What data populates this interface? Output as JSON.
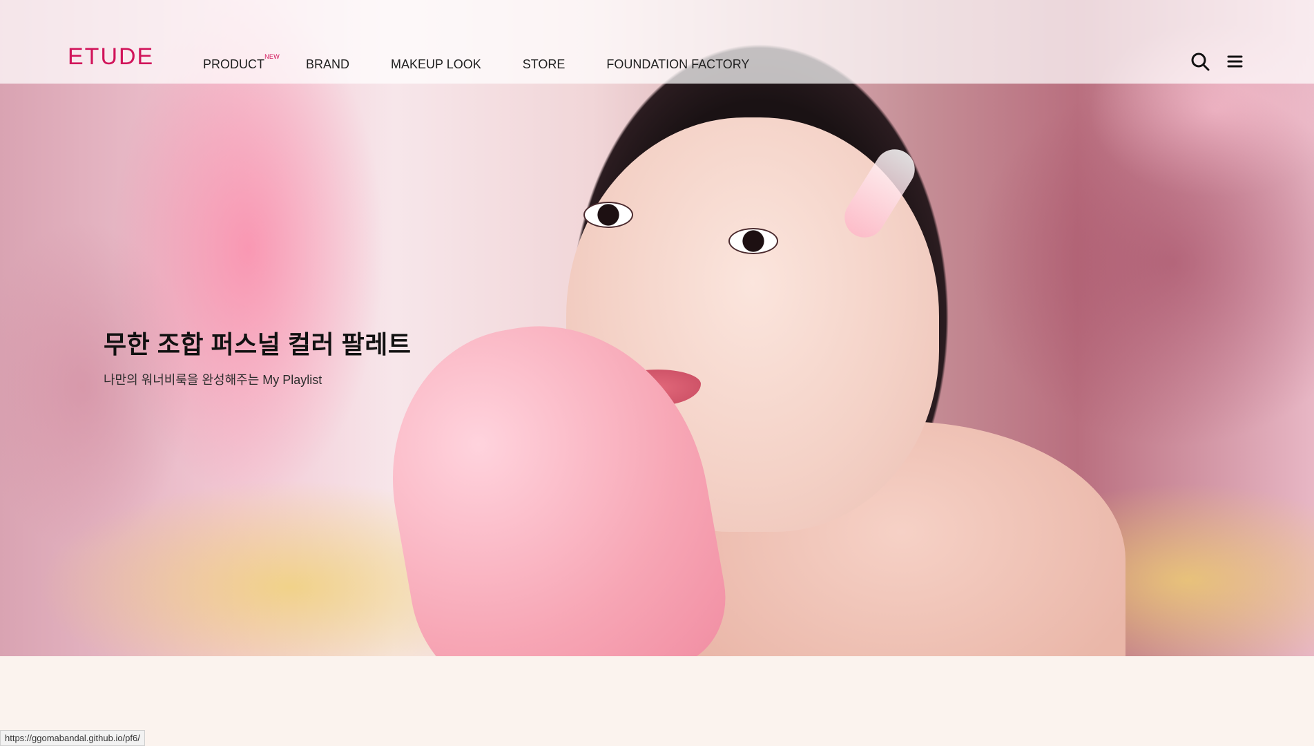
{
  "header": {
    "logo": "ETUDE",
    "nav": [
      {
        "label": "PRODUCT",
        "badge": "NEW"
      },
      {
        "label": "BRAND"
      },
      {
        "label": "MAKEUP LOOK"
      },
      {
        "label": "STORE"
      },
      {
        "label": "FOUNDATION FACTORY"
      }
    ],
    "icons": [
      "search-icon",
      "menu-icon"
    ]
  },
  "hero": {
    "title": "무한 조합 퍼스널 컬러 팔레트",
    "subtitle": "나만의 워너비룩을 완성해주는 My Playlist"
  },
  "status": {
    "url": "https://ggomabandal.github.io/pf6/"
  },
  "colors": {
    "brand": "#d1145a",
    "page_bg": "#fbf3ee"
  }
}
